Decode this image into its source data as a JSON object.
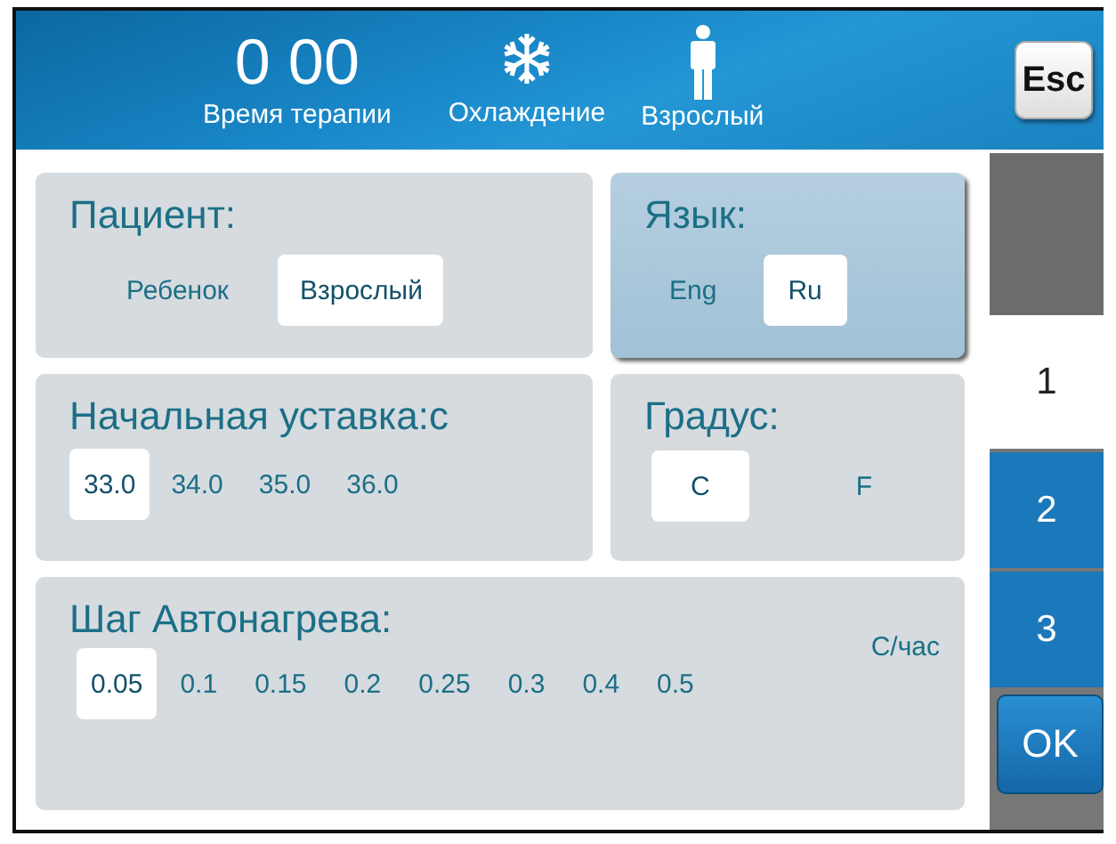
{
  "header": {
    "therapy_time": "0 00",
    "therapy_time_label": "Время терапии",
    "mode_label": "Охлаждение",
    "patient_label": "Взрослый",
    "esc_button": "Esc"
  },
  "panels": [
    {
      "title": "Пациент:",
      "selected": false,
      "options": [
        {
          "label": "Ребенок",
          "selected": false
        },
        {
          "label": "Взрослый",
          "selected": true
        }
      ]
    },
    {
      "title": "Язык:",
      "selected": true,
      "options": [
        {
          "label": "Eng",
          "selected": false
        },
        {
          "label": "Ru",
          "selected": true
        }
      ]
    },
    {
      "title": "Начальная уставка:c",
      "selected": false,
      "options": [
        {
          "label": "33.0",
          "selected": true
        },
        {
          "label": "34.0",
          "selected": false
        },
        {
          "label": "35.0",
          "selected": false
        },
        {
          "label": "36.0",
          "selected": false
        }
      ]
    },
    {
      "title": "Градус:",
      "selected": false,
      "options": [
        {
          "label": "C",
          "selected": true
        },
        {
          "label": "F",
          "selected": false
        }
      ]
    },
    {
      "title": "Шаг Автонагрева:",
      "unit": "C/час",
      "selected": false,
      "options": [
        {
          "label": "0.05",
          "selected": true
        },
        {
          "label": "0.1",
          "selected": false
        },
        {
          "label": "0.15",
          "selected": false
        },
        {
          "label": "0.2",
          "selected": false
        },
        {
          "label": "0.25",
          "selected": false
        },
        {
          "label": "0.3",
          "selected": false
        },
        {
          "label": "0.4",
          "selected": false
        },
        {
          "label": "0.5",
          "selected": false
        }
      ]
    }
  ],
  "tabs": [
    {
      "label": "1",
      "selected": true
    },
    {
      "label": "2",
      "selected": false
    },
    {
      "label": "3",
      "selected": false
    }
  ],
  "ok_button": "OK"
}
